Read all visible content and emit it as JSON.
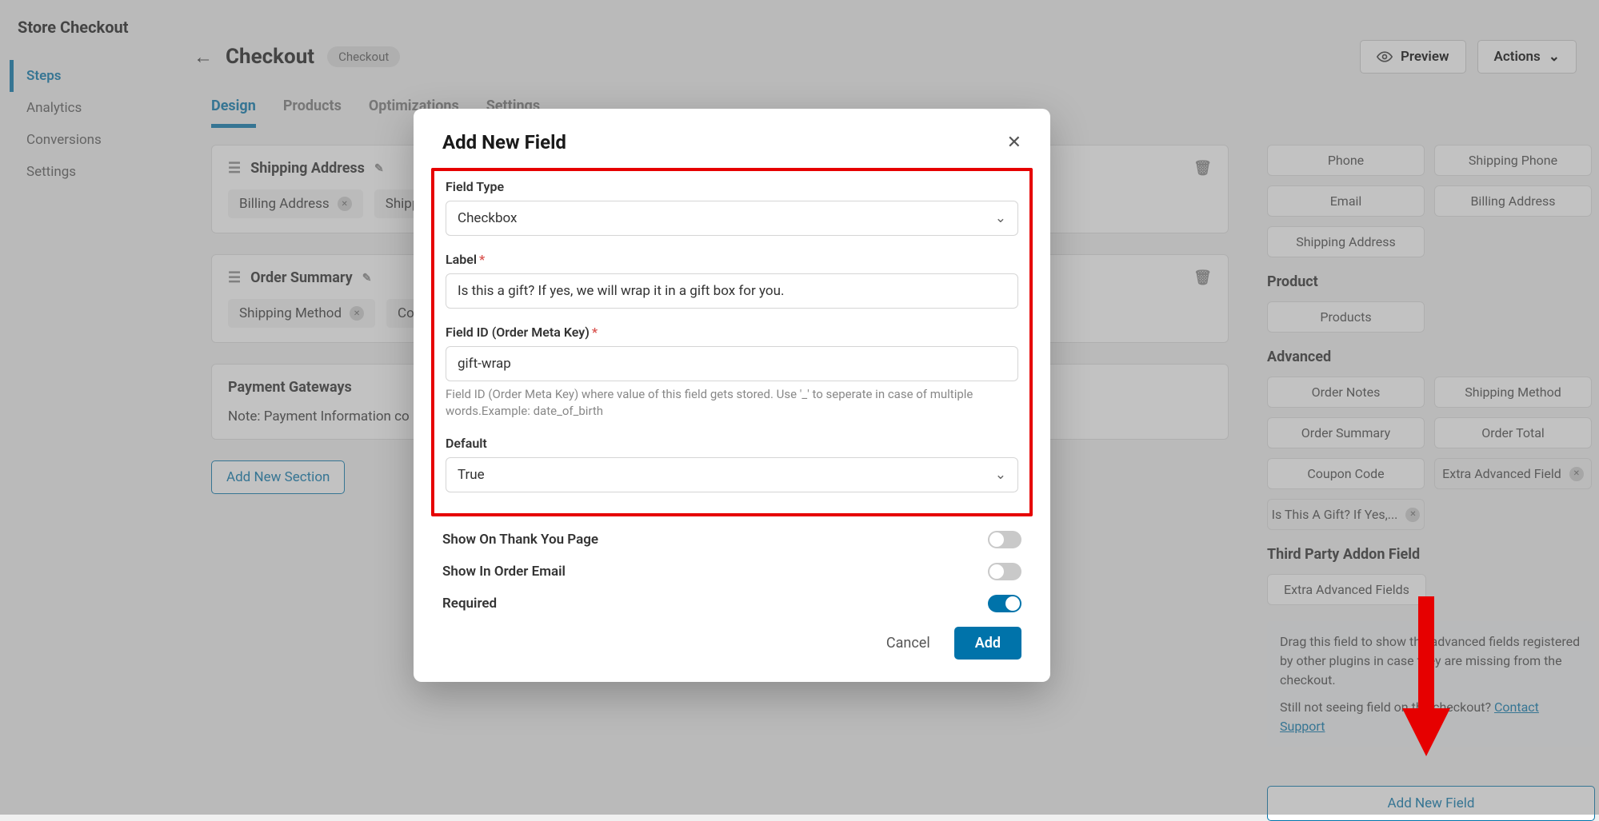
{
  "store_title": "Store Checkout",
  "sidebar": {
    "items": [
      {
        "label": "Steps"
      },
      {
        "label": "Analytics"
      },
      {
        "label": "Conversions"
      },
      {
        "label": "Settings"
      }
    ]
  },
  "header": {
    "title": "Checkout",
    "badge": "Checkout",
    "preview": "Preview",
    "actions": "Actions"
  },
  "tabs": [
    {
      "label": "Design"
    },
    {
      "label": "Products"
    },
    {
      "label": "Optimizations"
    },
    {
      "label": "Settings"
    }
  ],
  "sections": {
    "shipping_address": {
      "title": "Shipping Address",
      "chips": [
        {
          "label": "Billing Address"
        },
        {
          "label": "Shipp"
        }
      ]
    },
    "order_summary": {
      "title": "Order Summary",
      "chips": [
        {
          "label": "Shipping Method"
        },
        {
          "label": "Cou"
        }
      ]
    },
    "payment": {
      "title": "Payment Gateways",
      "note": "Note: Payment Information co"
    }
  },
  "add_section": "Add New Section",
  "rightbar": {
    "row1": [
      "Phone",
      "Shipping Phone"
    ],
    "row2": [
      "Email",
      "Billing Address"
    ],
    "row3": [
      "Shipping Address"
    ],
    "product_heading": "Product",
    "product_items": [
      "Products"
    ],
    "advanced_heading": "Advanced",
    "advanced_row1": [
      "Order Notes",
      "Shipping Method"
    ],
    "advanced_row2": [
      "Order Summary",
      "Order Total"
    ],
    "advanced_row3": [
      "Coupon Code"
    ],
    "advanced_chips": [
      "Extra Advanced Field",
      "Is This A Gift? If Yes,..."
    ],
    "thirdparty_heading": "Third Party Addon Field",
    "thirdparty_items": [
      "Extra Advanced Fields"
    ],
    "note_text_1": "Drag this field to show the advanced fields registered by other plugins in case they are missing from the checkout.",
    "note_text_2a": "Still not seeing field on the checkout? ",
    "note_link": "Contact Support",
    "add_field": "Add New Field"
  },
  "modal": {
    "title": "Add New Field",
    "field_type_label": "Field Type",
    "field_type_value": "Checkbox",
    "label_label": "Label",
    "label_value": "Is this a gift? If yes, we will wrap it in a gift box for you.",
    "fieldid_label": "Field ID (Order Meta Key)",
    "fieldid_value": "gift-wrap",
    "fieldid_help": "Field ID (Order Meta Key) where value of this field gets stored. Use '_' to seperate in case of multiple words.Example: date_of_birth",
    "default_label": "Default",
    "default_value": "True",
    "show_thankyou": "Show On Thank You Page",
    "show_email": "Show In Order Email",
    "required": "Required",
    "cancel": "Cancel",
    "add": "Add"
  }
}
